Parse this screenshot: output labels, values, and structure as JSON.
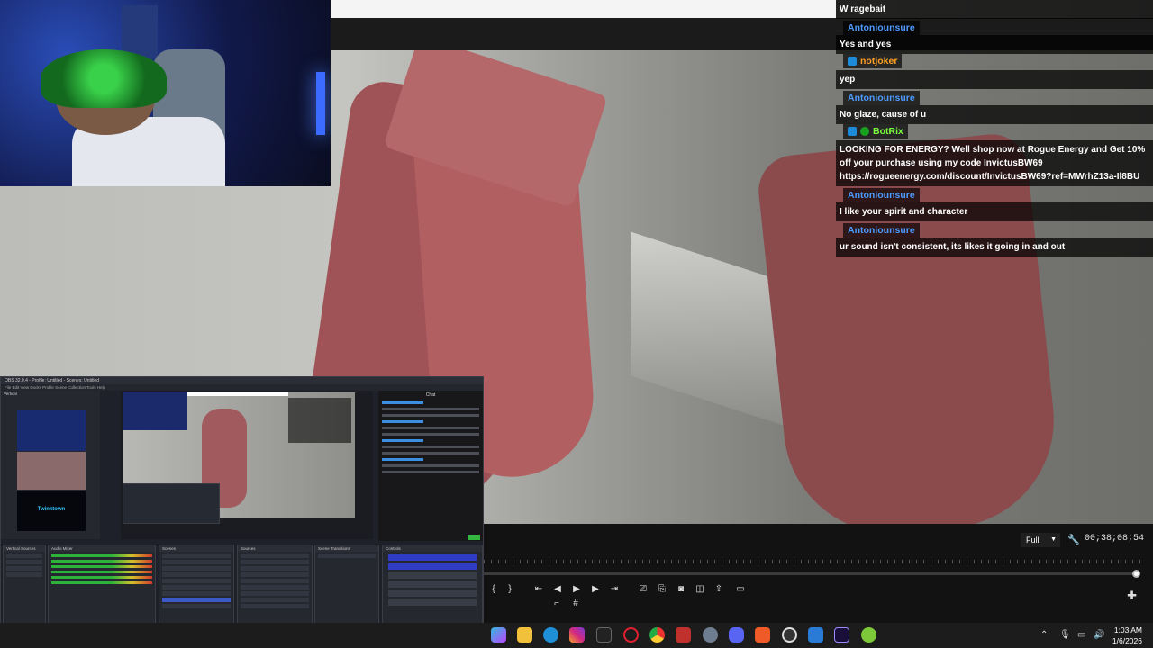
{
  "chat": {
    "messages": [
      {
        "user": "",
        "text": "W ragebait",
        "color": "#4d9bff",
        "badges": []
      },
      {
        "user": "Antoniounsure",
        "text": "Yes and yes",
        "color": "#4d9bff",
        "badges": []
      },
      {
        "user": "notjoker",
        "text": "yep",
        "color": "#ff9f22",
        "badges": [
          "blue"
        ]
      },
      {
        "user": "Antoniounsure",
        "text": "No glaze, cause of u",
        "color": "#4d9bff",
        "badges": []
      },
      {
        "user": "BotRix",
        "text": "LOOKING FOR ENERGY? Well shop now at Rogue Energy and Get 10% off your purchase using my code InvictusBW69 https://rogueenergy.com/discount/InvictusBW69?ref=MWrhZ13a-Il8BU",
        "color": "#7bff3f",
        "badges": [
          "blue",
          "green"
        ]
      },
      {
        "user": "Antoniounsure",
        "text": "I like your spirit and character",
        "color": "#4d9bff",
        "badges": []
      },
      {
        "user": "Antoniounsure",
        "text": "ur sound isn't consistent, its likes it going in and out",
        "color": "#4d9bff",
        "badges": []
      }
    ]
  },
  "player": {
    "quality": "Full",
    "timecode": "00;38;08;54",
    "progress": 0.995
  },
  "obs": {
    "title": "OBS 32.0.4 - Profile: Untitled - Scenes: Untitled",
    "menu": "File  Edit  View  Docks  Profile  Scene Collection  Tools  Help",
    "preview_label": "Vertical",
    "logo_text": "Twinktown",
    "chat_title": "Chat",
    "docks": [
      "Vertical Sources",
      "Audio Mixer",
      "Scenes",
      "Sources",
      "Scene Transitions",
      "Controls"
    ]
  },
  "taskbar": {
    "time": "1:03 AM",
    "date": "1/6/2026",
    "icons": [
      "copilot-icon",
      "file-explorer-icon",
      "edge-icon",
      "instagram-icon",
      "next-icon",
      "opera-icon",
      "chrome-icon",
      "video-icon",
      "settings-icon",
      "discord-icon",
      "brave-icon",
      "obs-icon",
      "photos-icon",
      "premiere-icon",
      "android-icon"
    ]
  },
  "colors": {
    "background": "#121212",
    "chat_bg": "rgba(0,0,0,0.72)",
    "accent": "#3c59c5"
  }
}
